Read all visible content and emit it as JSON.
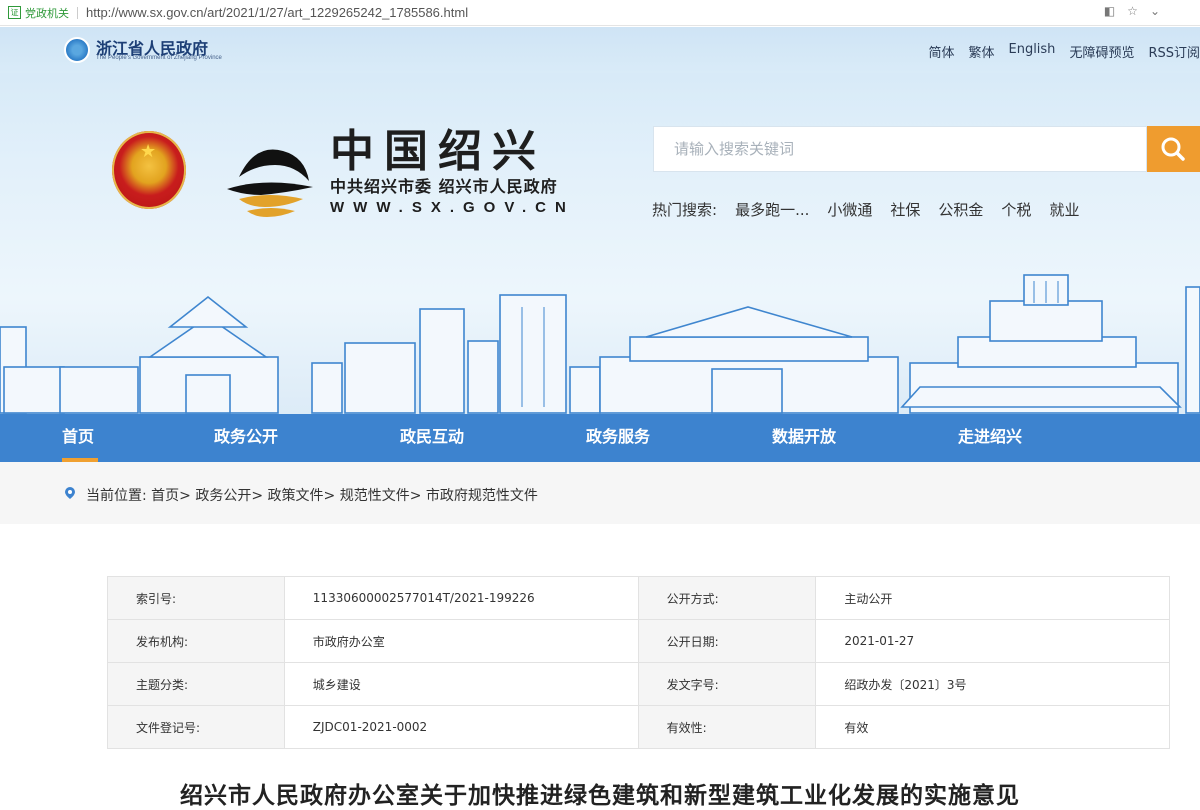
{
  "browser": {
    "cert_icon": "证",
    "cert_label": "党政机关",
    "url": "http://www.sx.gov.cn/art/2021/1/27/art_1229265242_1785586.html"
  },
  "header": {
    "province_name": "浙江省人民政府",
    "province_en": "The People's Government of Zhejiang Province",
    "top_links": [
      "简体",
      "繁体",
      "English",
      "无障碍预览",
      "RSS订阅"
    ],
    "site_title": "中国绍兴",
    "site_subtitle": "中共绍兴市委 绍兴市人民政府",
    "site_url": "WWW.SX.GOV.CN",
    "search_placeholder": "请输入搜索关键词",
    "hot_label": "热门搜索:",
    "hot_terms": [
      "最多跑一...",
      "小微通",
      "社保",
      "公积金",
      "个税",
      "就业"
    ]
  },
  "nav": {
    "items": [
      "首页",
      "政务公开",
      "政民互动",
      "政务服务",
      "数据开放",
      "走进绍兴"
    ],
    "active_index": 0,
    "active_color": "#f0a030",
    "bar_color": "#3d83cf"
  },
  "breadcrumb": {
    "label": "当前位置:",
    "path": "首页> 政务公开> 政策文件> 规范性文件> 市政府规范性文件"
  },
  "info_table": {
    "rows": [
      [
        "索引号:",
        "11330600002577014T/2021-199226",
        "公开方式:",
        "主动公开"
      ],
      [
        "发布机构:",
        "市政府办公室",
        "公开日期:",
        "2021-01-27"
      ],
      [
        "主题分类:",
        "城乡建设",
        "发文字号:",
        "绍政办发〔2021〕3号"
      ],
      [
        "文件登记号:",
        "ZJDC01-2021-0002",
        "有效性:",
        "有效"
      ]
    ]
  },
  "document": {
    "title": "绍兴市人民政府办公室关于加快推进绿色建筑和新型建筑工业化发展的实施意见"
  },
  "icons": {
    "cert": "certificate-icon",
    "reader": "reader-mode-icon",
    "favorite": "star-icon",
    "search": "search-icon",
    "location": "location-pin-icon"
  }
}
